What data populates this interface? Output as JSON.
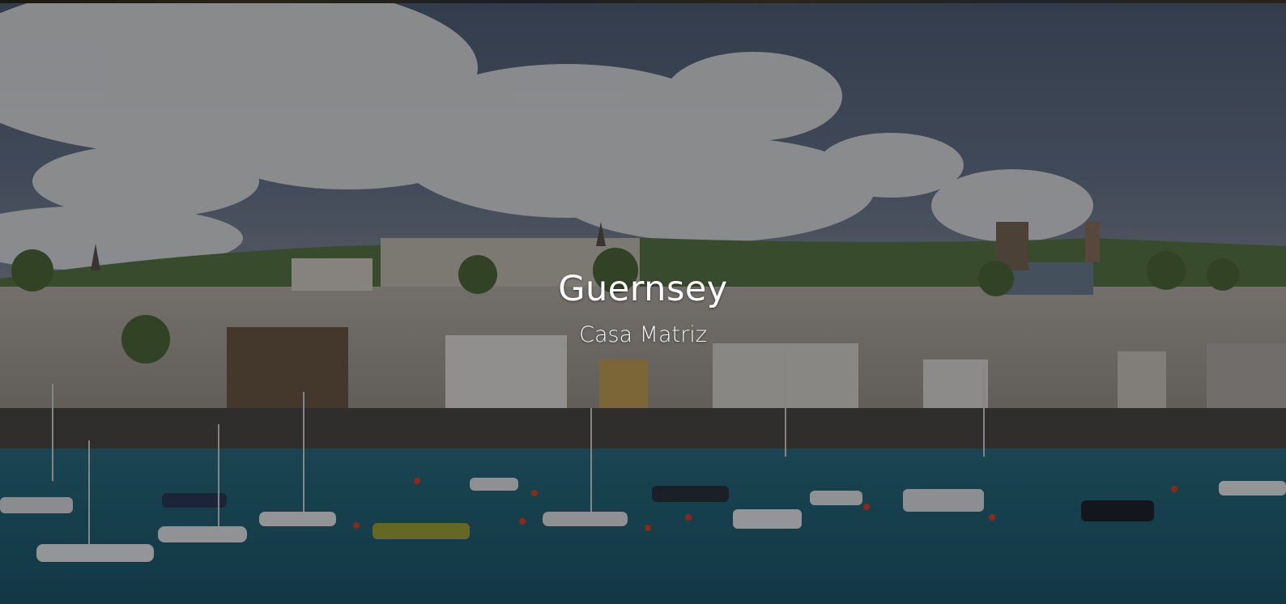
{
  "hero": {
    "title": "Guernsey",
    "subtitle": "Casa Matriz",
    "background": "harbour-town-photo"
  },
  "colors": {
    "sky": "#3f4d63",
    "cloud": "#d7dbe0",
    "town": "#8e8a86",
    "water": "#1f5c73",
    "overlay": "rgba(0,0,0,0.38)",
    "text": "#ffffff"
  }
}
